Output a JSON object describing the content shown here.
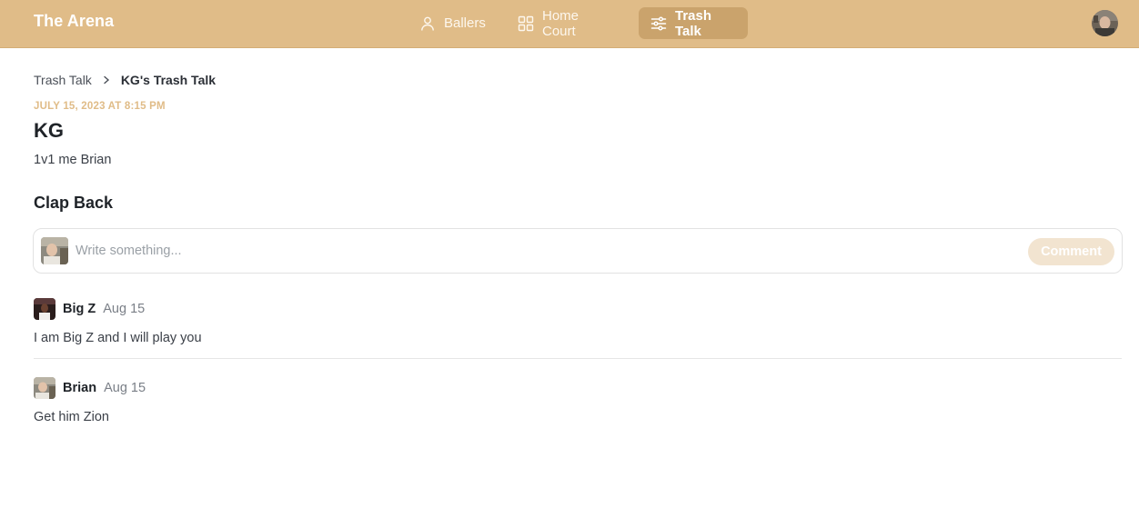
{
  "app": {
    "brand": "The Arena"
  },
  "nav": {
    "items": [
      {
        "label": "Ballers",
        "icon": "user-icon",
        "active": false
      },
      {
        "label": "Home Court",
        "icon": "grid-icon",
        "active": false
      },
      {
        "label": "Trash Talk",
        "icon": "sliders-icon",
        "active": true
      }
    ]
  },
  "breadcrumb": {
    "root": "Trash Talk",
    "current": "KG's Trash Talk"
  },
  "post": {
    "date": "JULY 15, 2023 AT 8:15 PM",
    "author": "KG",
    "body": "1v1 me Brian"
  },
  "clapback": {
    "title": "Clap Back",
    "placeholder": "Write something...",
    "button_label": "Comment"
  },
  "comments": [
    {
      "name": "Big Z",
      "date": "Aug 15",
      "text": "I am Big Z and I will play you"
    },
    {
      "name": "Brian",
      "date": "Aug 15",
      "text": "Get him Zion"
    }
  ],
  "colors": {
    "brand": "#e0bc88",
    "nav_active": "#caa36c",
    "button_disabled": "#f2e4d0"
  }
}
